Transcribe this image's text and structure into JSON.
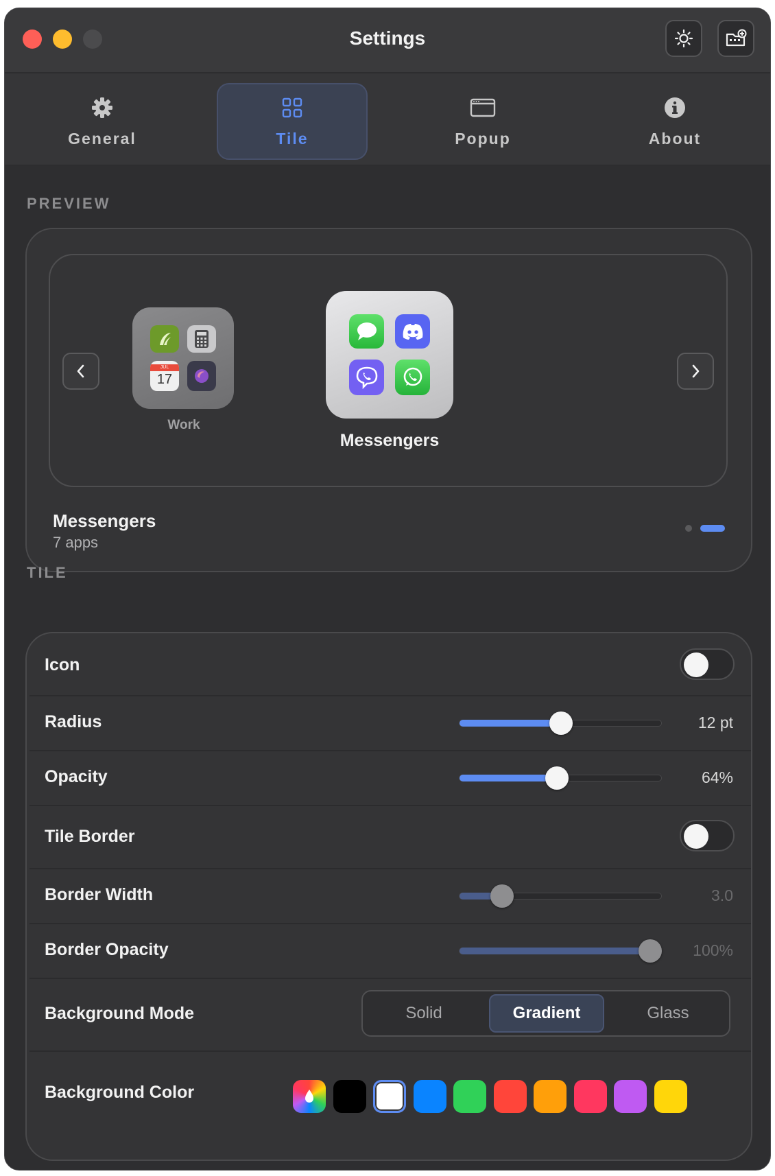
{
  "window": {
    "title": "Settings"
  },
  "toolbar": {
    "theme_icon": "sun-icon",
    "add_icon": "add-folder-icon"
  },
  "tabs": [
    {
      "label": "General",
      "icon": "gear-icon"
    },
    {
      "label": "Tile",
      "icon": "grid-icon",
      "selected": true
    },
    {
      "label": "Popup",
      "icon": "window-icon"
    },
    {
      "label": "About",
      "icon": "info-icon"
    }
  ],
  "preview": {
    "section_title": "PREVIEW",
    "folders": [
      {
        "label": "Work",
        "apps": [
          "feedly-icon",
          "calculator-icon",
          "calendar-icon",
          "arc-icon"
        ],
        "calendar_month": "JUL",
        "calendar_day": "17"
      },
      {
        "label": "Messengers",
        "apps": [
          "messages-icon",
          "discord-icon",
          "viber-icon",
          "whatsapp-icon"
        ]
      }
    ],
    "group_name": "Messengers",
    "group_count": "7 apps",
    "page_total": 2,
    "page_current": 2
  },
  "tile": {
    "section_title": "TILE",
    "icon": {
      "label": "Icon",
      "on": false
    },
    "radius": {
      "label": "Radius",
      "value": "12 pt",
      "fraction": 0.5
    },
    "opacity": {
      "label": "Opacity",
      "value": "64%",
      "fraction": 0.48
    },
    "tile_border": {
      "label": "Tile Border",
      "on": false
    },
    "border_width": {
      "label": "Border Width",
      "value": "3.0",
      "fraction": 0.21
    },
    "border_opacity": {
      "label": "Border Opacity",
      "value": "100%",
      "fraction": 0.94
    },
    "background_mode": {
      "label": "Background Mode",
      "options": [
        "Solid",
        "Gradient",
        "Glass"
      ],
      "selected": "Gradient"
    },
    "background_color": {
      "label": "Background Color",
      "swatches": [
        "multicolor",
        "#000000",
        "#ffffff",
        "#0a84ff",
        "#30d158",
        "#ff453a",
        "#ff9f0a",
        "#ff375f",
        "#bf5af2",
        "#ffd60a"
      ],
      "selected": "#ffffff"
    }
  },
  "colors": {
    "accent": "#5d8cf2",
    "window_bg": "#2e2e30"
  }
}
